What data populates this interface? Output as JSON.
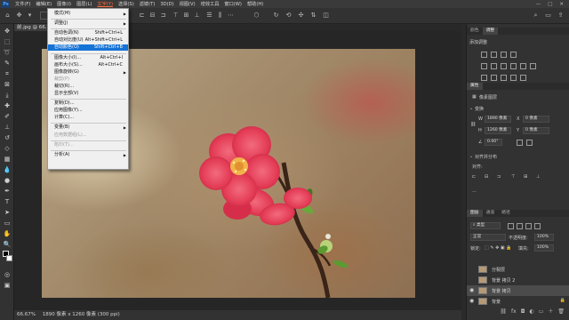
{
  "menubar": {
    "logo": "Ps",
    "items": [
      "文件(F)",
      "编辑(E)",
      "图像(I)",
      "图层(L)",
      "文字(Y)",
      "选择(S)",
      "滤镜(T)",
      "3D(D)",
      "视图(V)",
      "增效工具",
      "窗口(W)",
      "帮助(H)"
    ],
    "active_index": 4,
    "window_controls": [
      "—",
      "□",
      "✕"
    ]
  },
  "document": {
    "tab_title": "前.jpg @ 66.7...",
    "status": {
      "zoom": "66.67%",
      "size": "1890 像素 x 1260 像素 (300 ppi)"
    }
  },
  "image_menu": {
    "items": [
      {
        "label": "模式(M)",
        "arrow": true
      },
      {
        "sep": true
      },
      {
        "label": "调整(J)",
        "arrow": true
      },
      {
        "sep": true
      },
      {
        "label": "自动色调(N)",
        "shortcut": "Shift+Ctrl+L"
      },
      {
        "label": "自动对比度(U)",
        "shortcut": "Alt+Shift+Ctrl+L"
      },
      {
        "label": "自动颜色(O)",
        "shortcut": "Shift+Ctrl+B",
        "highlighted": true
      },
      {
        "sep": true
      },
      {
        "label": "图像大小(I)...",
        "shortcut": "Alt+Ctrl+I"
      },
      {
        "label": "画布大小(S)...",
        "shortcut": "Alt+Ctrl+C"
      },
      {
        "label": "图像旋转(G)",
        "arrow": true
      },
      {
        "label": "裁剪(P)",
        "disabled": true
      },
      {
        "label": "裁切(R)..."
      },
      {
        "label": "显示全部(V)"
      },
      {
        "sep": true
      },
      {
        "label": "复制(D)..."
      },
      {
        "label": "应用图像(Y)..."
      },
      {
        "label": "计算(C)..."
      },
      {
        "sep": true
      },
      {
        "label": "变量(B)",
        "arrow": true
      },
      {
        "label": "应用数据组(L)...",
        "disabled": true
      },
      {
        "sep": true
      },
      {
        "label": "陷印(T)...",
        "disabled": true
      },
      {
        "sep": true
      },
      {
        "label": "分析(A)",
        "arrow": true
      }
    ]
  },
  "panels": {
    "adjust_tabs": [
      "颜色",
      "调整"
    ],
    "adjust_active": 1,
    "adjust_add_label": "添加调整",
    "props_title": "属性",
    "props_subtitle": "像素图层",
    "transform_label": "变换",
    "w_label": "W",
    "w_value": "1890 像素",
    "x_label": "X",
    "x_value": "0 像素",
    "h_label": "H",
    "h_value": "1260 像素",
    "y_label": "Y",
    "y_value": "0 像素",
    "angle_value": "0.00°",
    "align_label": "对齐并分布",
    "align_sub": "对齐:",
    "layers_tabs": [
      "图层",
      "通道",
      "路径"
    ],
    "layers_active": 0,
    "kind_label": "类型",
    "blend_mode": "正常",
    "opacity_label": "不透明度:",
    "opacity_value": "100%",
    "lock_label": "锁定:",
    "fill_label": "填充:",
    "fill_value": "100%",
    "layers": [
      {
        "name": "分裂层",
        "visible": false,
        "selected": false,
        "locked": false
      },
      {
        "name": "背景 拷贝 2",
        "visible": false,
        "selected": false,
        "locked": false
      },
      {
        "name": "背景 拷贝",
        "visible": true,
        "selected": true,
        "locked": false
      },
      {
        "name": "背景",
        "visible": true,
        "selected": false,
        "locked": true
      }
    ]
  }
}
